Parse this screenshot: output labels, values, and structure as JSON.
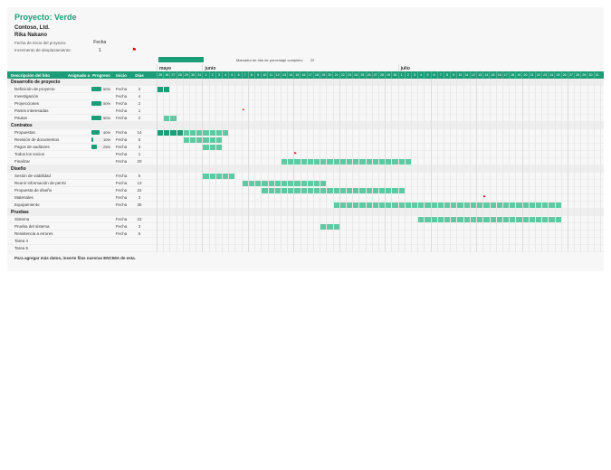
{
  "title": "Proyecto: Verde",
  "company": "Contoso, Ltd.",
  "lead": "Rika Nakano",
  "start_label": "Fecha de inicio del proyecto:",
  "start_value": "Fecha",
  "scroll_label": "Incremento de desplazamiento:",
  "scroll_value": "1",
  "legend_milestone_label": "Marcador de hito de porcentaje completo:",
  "legend_milestone_value": "22",
  "columns": {
    "c1": "Descripción del hito",
    "c2": "Asignado a",
    "c3": "Progreso",
    "c4": "Inicio",
    "c5": "Días"
  },
  "months": [
    "mayo",
    "junio",
    "julio"
  ],
  "days_per_month": [
    31,
    30,
    31
  ],
  "start_day_offset": 25,
  "sections": [
    {
      "name": "Desarrollo de proyecto",
      "tasks": [
        {
          "name": "Definición de proyecto",
          "progress": 50,
          "start": "Fecha",
          "days": 2,
          "bar_start": 0,
          "bar_len": 2,
          "dark": true
        },
        {
          "name": "Investigación",
          "progress": null,
          "start": "Fecha",
          "days": 4,
          "bar_start": null
        },
        {
          "name": "Proyecciones",
          "progress": 50,
          "start": "Fecha",
          "days": 2,
          "bar_start": null
        },
        {
          "name": "Partes interesadas",
          "progress": null,
          "start": "Fecha",
          "days": 1,
          "bar_start": null,
          "flag": true,
          "flag_at": 13
        },
        {
          "name": "Pautas",
          "progress": 50,
          "start": "Fecha",
          "days": 2,
          "bar_start": 1,
          "bar_len": 2,
          "dark": false
        }
      ]
    },
    {
      "name": "Contratos",
      "tasks": [
        {
          "name": "Propuestas",
          "progress": 40,
          "start": "Fecha",
          "days": 14,
          "bar_start": 0,
          "bar_len": 11,
          "dark": true,
          "overlay_len": 4
        },
        {
          "name": "Revisión de documentos",
          "progress": 10,
          "start": "Fecha",
          "days": 6,
          "bar_start": 4,
          "bar_len": 6
        },
        {
          "name": "Pagos de auditores",
          "progress": 25,
          "start": "Fecha",
          "days": 3,
          "bar_start": 7,
          "bar_len": 3
        },
        {
          "name": "Todos los socios",
          "progress": null,
          "start": "Fecha",
          "days": 1,
          "bar_start": null,
          "flag": true,
          "flag_at": 21
        },
        {
          "name": "Finalizar",
          "progress": null,
          "start": "Fecha",
          "days": 20,
          "bar_start": 19,
          "bar_len": 20
        }
      ]
    },
    {
      "name": "Diseño",
      "tasks": [
        {
          "name": "Sesión de viabilidad",
          "progress": null,
          "start": "Fecha",
          "days": 5,
          "bar_start": 7,
          "bar_len": 5
        },
        {
          "name": "Reunir información de permisos",
          "progress": null,
          "start": "Fecha",
          "days": 13,
          "bar_start": 13,
          "bar_len": 13
        },
        {
          "name": "Propuesta de diseño",
          "progress": null,
          "start": "Fecha",
          "days": 22,
          "bar_start": 16,
          "bar_len": 22
        },
        {
          "name": "Materiales",
          "progress": null,
          "start": "Fecha",
          "days": 3,
          "bar_start": null,
          "flag": true,
          "flag_at": 50
        },
        {
          "name": "Equipamiento",
          "progress": null,
          "start": "Fecha",
          "days": 35,
          "bar_start": 27,
          "bar_len": 35
        }
      ]
    },
    {
      "name": "Pruebas",
      "tasks": [
        {
          "name": "Sistema",
          "progress": null,
          "start": "Fecha",
          "days": 22,
          "bar_start": 40,
          "bar_len": 22
        },
        {
          "name": "Prueba del sistema",
          "progress": null,
          "start": "Fecha",
          "days": 3,
          "bar_start": 25,
          "bar_len": 3
        },
        {
          "name": "Resistencia a errores",
          "progress": null,
          "start": "Fecha",
          "days": 6,
          "bar_start": null
        },
        {
          "name": "Tarea 4",
          "progress": null,
          "start": "",
          "days": "",
          "bar_start": null
        },
        {
          "name": "Tarea 5",
          "progress": null,
          "start": "",
          "days": "",
          "bar_start": null
        }
      ]
    }
  ],
  "footer": "Para agregar más datos, inserte filas nuevras ENCIMA de esta.",
  "chart_data": {
    "type": "gantt",
    "title": "Proyecto: Verde",
    "x_unit": "days",
    "x_range_days": 68,
    "months": [
      "mayo",
      "junio",
      "julio"
    ],
    "series": [
      {
        "section": "Desarrollo de proyecto",
        "task": "Definición de proyecto",
        "start_offset": 0,
        "duration": 2,
        "progress": 50
      },
      {
        "section": "Desarrollo de proyecto",
        "task": "Investigación",
        "start_offset": null,
        "duration": 4,
        "progress": null
      },
      {
        "section": "Desarrollo de proyecto",
        "task": "Proyecciones",
        "start_offset": null,
        "duration": 2,
        "progress": 50
      },
      {
        "section": "Desarrollo de proyecto",
        "task": "Partes interesadas",
        "start_offset": 13,
        "duration": 1,
        "progress": null,
        "milestone": true
      },
      {
        "section": "Desarrollo de proyecto",
        "task": "Pautas",
        "start_offset": 1,
        "duration": 2,
        "progress": 50
      },
      {
        "section": "Contratos",
        "task": "Propuestas",
        "start_offset": 0,
        "duration": 14,
        "progress": 40
      },
      {
        "section": "Contratos",
        "task": "Revisión de documentos",
        "start_offset": 4,
        "duration": 6,
        "progress": 10
      },
      {
        "section": "Contratos",
        "task": "Pagos de auditores",
        "start_offset": 7,
        "duration": 3,
        "progress": 25
      },
      {
        "section": "Contratos",
        "task": "Todos los socios",
        "start_offset": 21,
        "duration": 1,
        "progress": null,
        "milestone": true
      },
      {
        "section": "Contratos",
        "task": "Finalizar",
        "start_offset": 19,
        "duration": 20,
        "progress": null
      },
      {
        "section": "Diseño",
        "task": "Sesión de viabilidad",
        "start_offset": 7,
        "duration": 5,
        "progress": null
      },
      {
        "section": "Diseño",
        "task": "Reunir información de permisos",
        "start_offset": 13,
        "duration": 13,
        "progress": null
      },
      {
        "section": "Diseño",
        "task": "Propuesta de diseño",
        "start_offset": 16,
        "duration": 22,
        "progress": null
      },
      {
        "section": "Diseño",
        "task": "Materiales",
        "start_offset": 50,
        "duration": 3,
        "progress": null,
        "milestone": true
      },
      {
        "section": "Diseño",
        "task": "Equipamiento",
        "start_offset": 27,
        "duration": 35,
        "progress": null
      },
      {
        "section": "Pruebas",
        "task": "Sistema",
        "start_offset": 40,
        "duration": 22,
        "progress": null
      },
      {
        "section": "Pruebas",
        "task": "Prueba del sistema",
        "start_offset": 25,
        "duration": 3,
        "progress": null
      },
      {
        "section": "Pruebas",
        "task": "Resistencia a errores",
        "start_offset": null,
        "duration": 6,
        "progress": null
      }
    ]
  }
}
